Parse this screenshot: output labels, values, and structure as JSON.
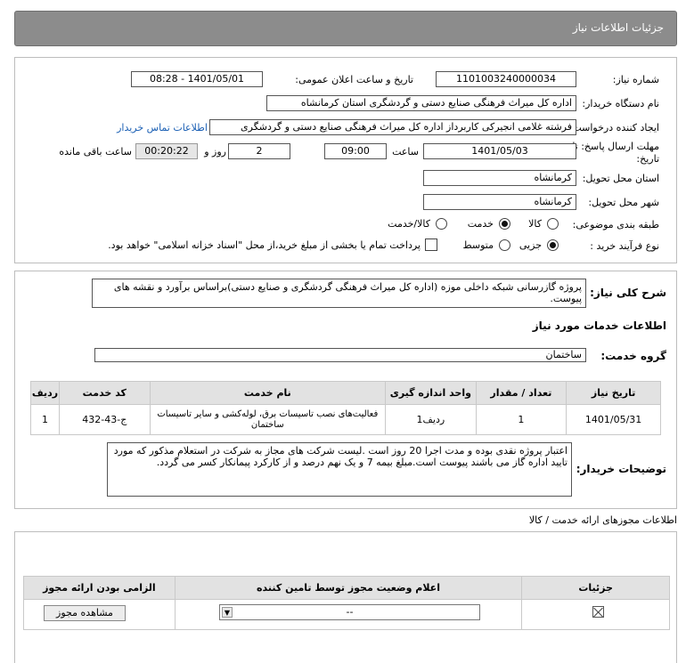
{
  "header": {
    "title": "جزئیات اطلاعات نیاز"
  },
  "form": {
    "need_number_label": "شماره نیاز:",
    "need_number": "1101003240000034",
    "announce_label": "تاریخ و ساعت اعلان عمومی:",
    "announce_value": "1401/05/01 - 08:28",
    "buyer_label": "نام دستگاه خریدار:",
    "buyer_value": "اداره کل میراث فرهنگی  صنایع دستی و گردشگری استان کرمانشاه",
    "requester_label": "ایجاد کننده درخواست:",
    "requester_value": "فرشته غلامی انجیرکی کاربرداز اداره کل میراث فرهنگی  صنایع دستی و گردشگری",
    "contact_link": "اطلاعات تماس خریدار",
    "deadline_label_1": "مهلت ارسال پاسخ: تا",
    "deadline_label_2": "تاریخ:",
    "deadline_date": "1401/05/03",
    "time_label": "ساعت",
    "deadline_time": "09:00",
    "days_value": "2",
    "days_label": "روز و",
    "remaining_time": "00:20:22",
    "remaining_label": "ساعت باقی مانده",
    "province_label": "استان محل تحویل:",
    "province_value": "کرمانشاه",
    "city_label": "شهر محل تحویل:",
    "city_value": "کرمانشاه",
    "category_label": "طبقه بندی موضوعی:",
    "category_options": [
      "کالا",
      "خدمت",
      "کالا/خدمت"
    ],
    "category_selected": "خدمت",
    "process_label": "نوع فرآیند خرید :",
    "process_options": [
      "جزیی",
      "متوسط"
    ],
    "process_selected": "جزیی",
    "payment_note": "پرداخت تمام یا بخشی از مبلغ خرید،از محل \"اسناد خزانه اسلامی\" خواهد بود."
  },
  "description": {
    "label": "شرح کلی نیاز:",
    "text": "پروژه گازرسانی شبکه داخلی موزه (اداره کل میراث فرهنگی گردشگری و صنایع دستی)براساس برآورد و نقشه های پیوست."
  },
  "services": {
    "section_title": "اطلاعات خدمات مورد نیاز",
    "group_label": "گروه خدمت:",
    "group_value": "ساختمان",
    "columns": [
      "ردیف",
      "کد خدمت",
      "نام خدمت",
      "واحد اندازه گیری",
      "تعداد / مقدار",
      "تاریخ نیاز"
    ],
    "rows": [
      [
        "1",
        "ج-43-432",
        "فعالیت‌های نصب تاسیسات برق، لوله‌کشی و سایر تاسیسات ساختمان",
        "ردیف1",
        "1",
        "1401/05/31"
      ]
    ]
  },
  "buyer_notes": {
    "label": "توضیحات خریدار:",
    "text": "اعتبار پروژه نقدی بوده و مدت اجرا 20 روز است .لیست شرکت های مجاز به شرکت در استعلام مذکور که مورد تایید اداره گاز می باشند پیوست است.مبلغ بیمه 7 و یک نهم درصد و از کارکرد پیمانکار کسر می گردد."
  },
  "permits": {
    "section_title": "اطلاعات مجوزهای ارائه خدمت / کالا",
    "columns": [
      "الزامی بودن ارائه مجوز",
      "اعلام وضعیت مجوز توسط تامین کننده",
      "جزئیات"
    ],
    "select_value": "--",
    "view_button": "مشاهده مجوز"
  }
}
